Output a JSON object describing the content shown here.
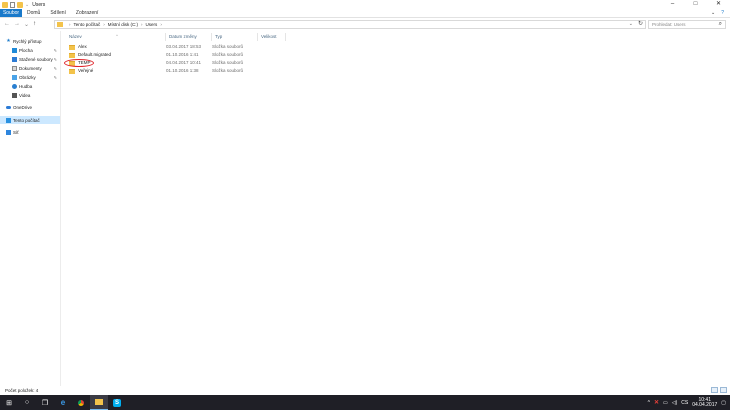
{
  "window": {
    "title": "Users",
    "controls": [
      "–",
      "□",
      "✕"
    ]
  },
  "ribbon": {
    "tabs": [
      "Soubor",
      "Domů",
      "Sdílení",
      "Zobrazení"
    ]
  },
  "address": {
    "path": [
      "Tento počítač",
      "Místní disk (C:)",
      "Users"
    ],
    "search_placeholder": "Prohledat: Users"
  },
  "navpane": {
    "items": [
      {
        "label": "Rychlý přístup",
        "icon": "star-icon"
      },
      {
        "label": "Plocha",
        "icon": "desktop-icon",
        "pinned": true
      },
      {
        "label": "Stažené soubory",
        "icon": "download-icon",
        "pinned": true
      },
      {
        "label": "Dokumenty",
        "icon": "documents-icon",
        "pinned": true
      },
      {
        "label": "Obrázky",
        "icon": "pictures-icon",
        "pinned": true
      },
      {
        "label": "Hudba",
        "icon": "music-icon"
      },
      {
        "label": "Videa",
        "icon": "videos-icon"
      },
      {
        "label": "OneDrive",
        "icon": "onedrive-icon"
      },
      {
        "label": "Tento počítač",
        "icon": "this-pc-icon",
        "selected": true
      },
      {
        "label": "Síť",
        "icon": "network-icon"
      }
    ]
  },
  "filelist": {
    "columns": [
      "Název",
      "Datum změny",
      "Typ",
      "Velikost"
    ],
    "rows": [
      {
        "name": "Alex",
        "date": "03.04.2017 18:53",
        "type": "Složka souborů"
      },
      {
        "name": "Default.migrated",
        "date": "01.10.2016 1:41",
        "type": "Složka souborů"
      },
      {
        "name": "TEMP",
        "date": "04.04.2017 10:41",
        "type": "Složka souborů",
        "circled": true
      },
      {
        "name": "Veřejné",
        "date": "01.10.2016 1:38",
        "type": "Složka souborů"
      }
    ]
  },
  "status": {
    "item_count": "Počet položek: 4"
  },
  "taskbar": {
    "clock_time": "10:41",
    "clock_date": "04.04.2017",
    "lang": "CS"
  },
  "colors": {
    "accent": "#1979ca",
    "folder": "#f3c34b",
    "highlight_ring": "#e0252b"
  }
}
